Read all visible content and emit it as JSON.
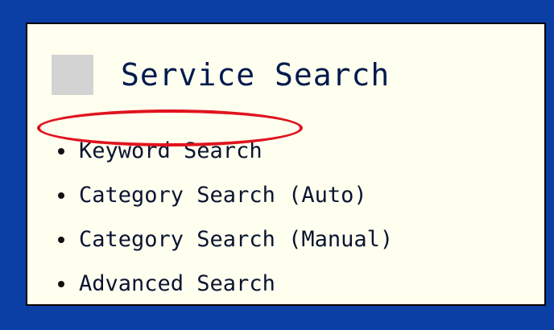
{
  "panel": {
    "title": "Service Search",
    "items": [
      {
        "label": "Keyword Search",
        "highlighted": true
      },
      {
        "label": "Category Search (Auto)",
        "highlighted": false
      },
      {
        "label": "Category Search (Manual)",
        "highlighted": false
      },
      {
        "label": "Advanced Search",
        "highlighted": false
      }
    ]
  },
  "colors": {
    "background": "#0b3fa6",
    "panel_background": "#fffff0",
    "title_square": "#d3d3d3",
    "highlight": "#e0141e"
  }
}
